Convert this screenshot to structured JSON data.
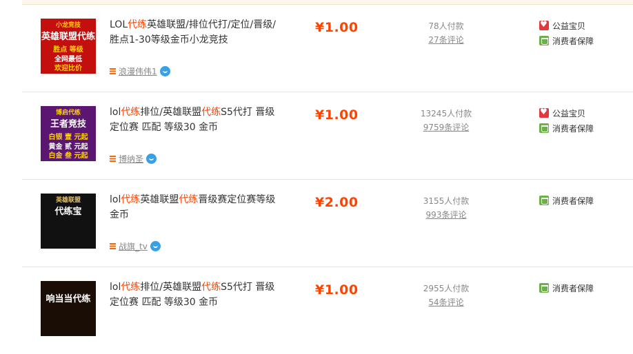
{
  "items": [
    {
      "title_parts": [
        {
          "text": "LOL",
          "kw": false
        },
        {
          "text": "代练",
          "kw": true
        },
        {
          "text": "英雄联盟/排位代打/定位/晋级/胜点1-30等级金币小龙竞技",
          "kw": false
        }
      ],
      "shop": "浪漫伟伟1",
      "price": "¥1.00",
      "paid": "78人付款",
      "reviews": "27条评论",
      "badges": [
        {
          "icon": "heart-icon",
          "label": "公益宝贝"
        },
        {
          "icon": "shield-icon",
          "label": "消费者保障"
        }
      ],
      "thumb": {
        "lines": [
          "小龙竞技",
          "英雄联盟代练",
          "胜点 等级",
          "全网最低",
          "欢迎比价"
        ],
        "bg": "#c40f0f",
        "accent": "#ffd400"
      }
    },
    {
      "title_parts": [
        {
          "text": "lol",
          "kw": false
        },
        {
          "text": "代练",
          "kw": true
        },
        {
          "text": "排位/英雄联盟",
          "kw": false
        },
        {
          "text": "代练",
          "kw": true
        },
        {
          "text": "S5代打 晋级定位赛 匹配 等级30 金币",
          "kw": false
        }
      ],
      "shop": "博纳圣",
      "price": "¥1.00",
      "paid": "13245人付款",
      "reviews": "9759条评论",
      "badges": [
        {
          "icon": "heart-icon",
          "label": "公益宝贝"
        },
        {
          "icon": "shield-icon",
          "label": "消费者保障"
        }
      ],
      "thumb": {
        "lines": [
          "博启代练",
          "王者竞技",
          "白银 壹 元起",
          "黄金 贰 元起",
          "白金 叁 元起"
        ],
        "bg": "#5a1670",
        "accent": "#ffd400"
      }
    },
    {
      "title_parts": [
        {
          "text": "lol",
          "kw": false
        },
        {
          "text": "代练",
          "kw": true
        },
        {
          "text": "英雄联盟",
          "kw": false
        },
        {
          "text": "代练",
          "kw": true
        },
        {
          "text": "晋级赛定位赛等级金币",
          "kw": false
        }
      ],
      "shop": "战旗_tv",
      "price": "¥2.00",
      "paid": "3155人付款",
      "reviews": "993条评论",
      "badges": [
        {
          "icon": "shield-icon",
          "label": "消费者保障"
        }
      ],
      "thumb": {
        "lines": [
          "英雄联盟",
          "代练宝",
          "",
          "",
          ""
        ],
        "bg": "#111111",
        "accent": "#e8c060"
      }
    },
    {
      "title_parts": [
        {
          "text": "lol",
          "kw": false
        },
        {
          "text": "代练",
          "kw": true
        },
        {
          "text": "排位/英雄联盟",
          "kw": false
        },
        {
          "text": "代练",
          "kw": true
        },
        {
          "text": "S5代打 晋级定位赛 匹配 等级30 金币",
          "kw": false
        }
      ],
      "shop": "",
      "price": "¥1.00",
      "paid": "2955人付款",
      "reviews": "54条评论",
      "badges": [
        {
          "icon": "shield-icon",
          "label": "消费者保障"
        }
      ],
      "thumb": {
        "lines": [
          "",
          "响当当代练",
          "",
          "",
          ""
        ],
        "bg": "#1a0d05",
        "accent": "#ffb400"
      }
    }
  ]
}
